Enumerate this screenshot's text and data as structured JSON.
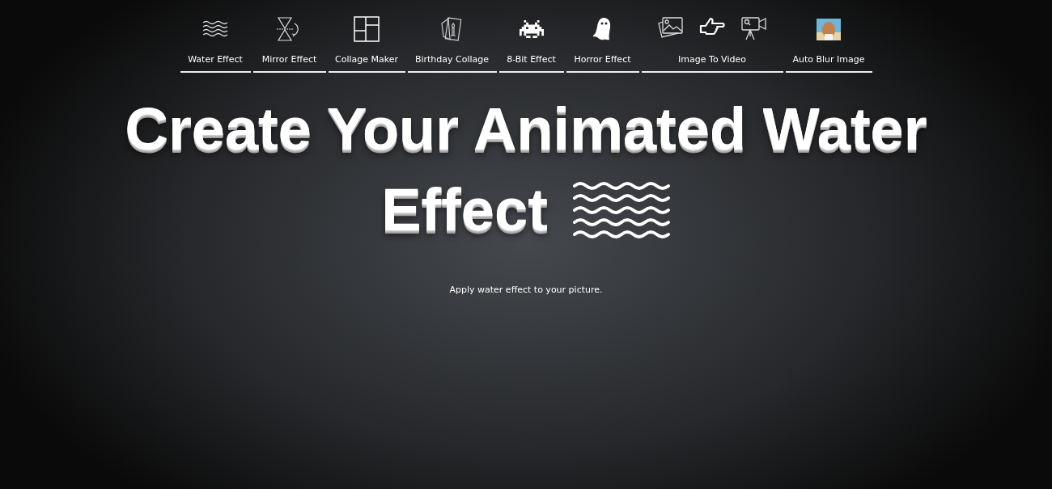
{
  "nav": [
    {
      "label": "Water Effect",
      "kind": "waves"
    },
    {
      "label": "Mirror Effect",
      "kind": "mirror"
    },
    {
      "label": "Collage Maker",
      "kind": "collage"
    },
    {
      "label": "Birthday Collage",
      "kind": "birthday"
    },
    {
      "label": "8-Bit Effect",
      "kind": "pixel"
    },
    {
      "label": "Horror Effect",
      "kind": "ghost"
    },
    {
      "label": "Image To Video",
      "kind": "video"
    },
    {
      "label": "Auto Blur Image",
      "kind": "photo"
    }
  ],
  "hero": {
    "title_line1": "Create Your Animated Water",
    "title_line2": "Effect",
    "subtitle": "Apply water effect to your picture."
  }
}
